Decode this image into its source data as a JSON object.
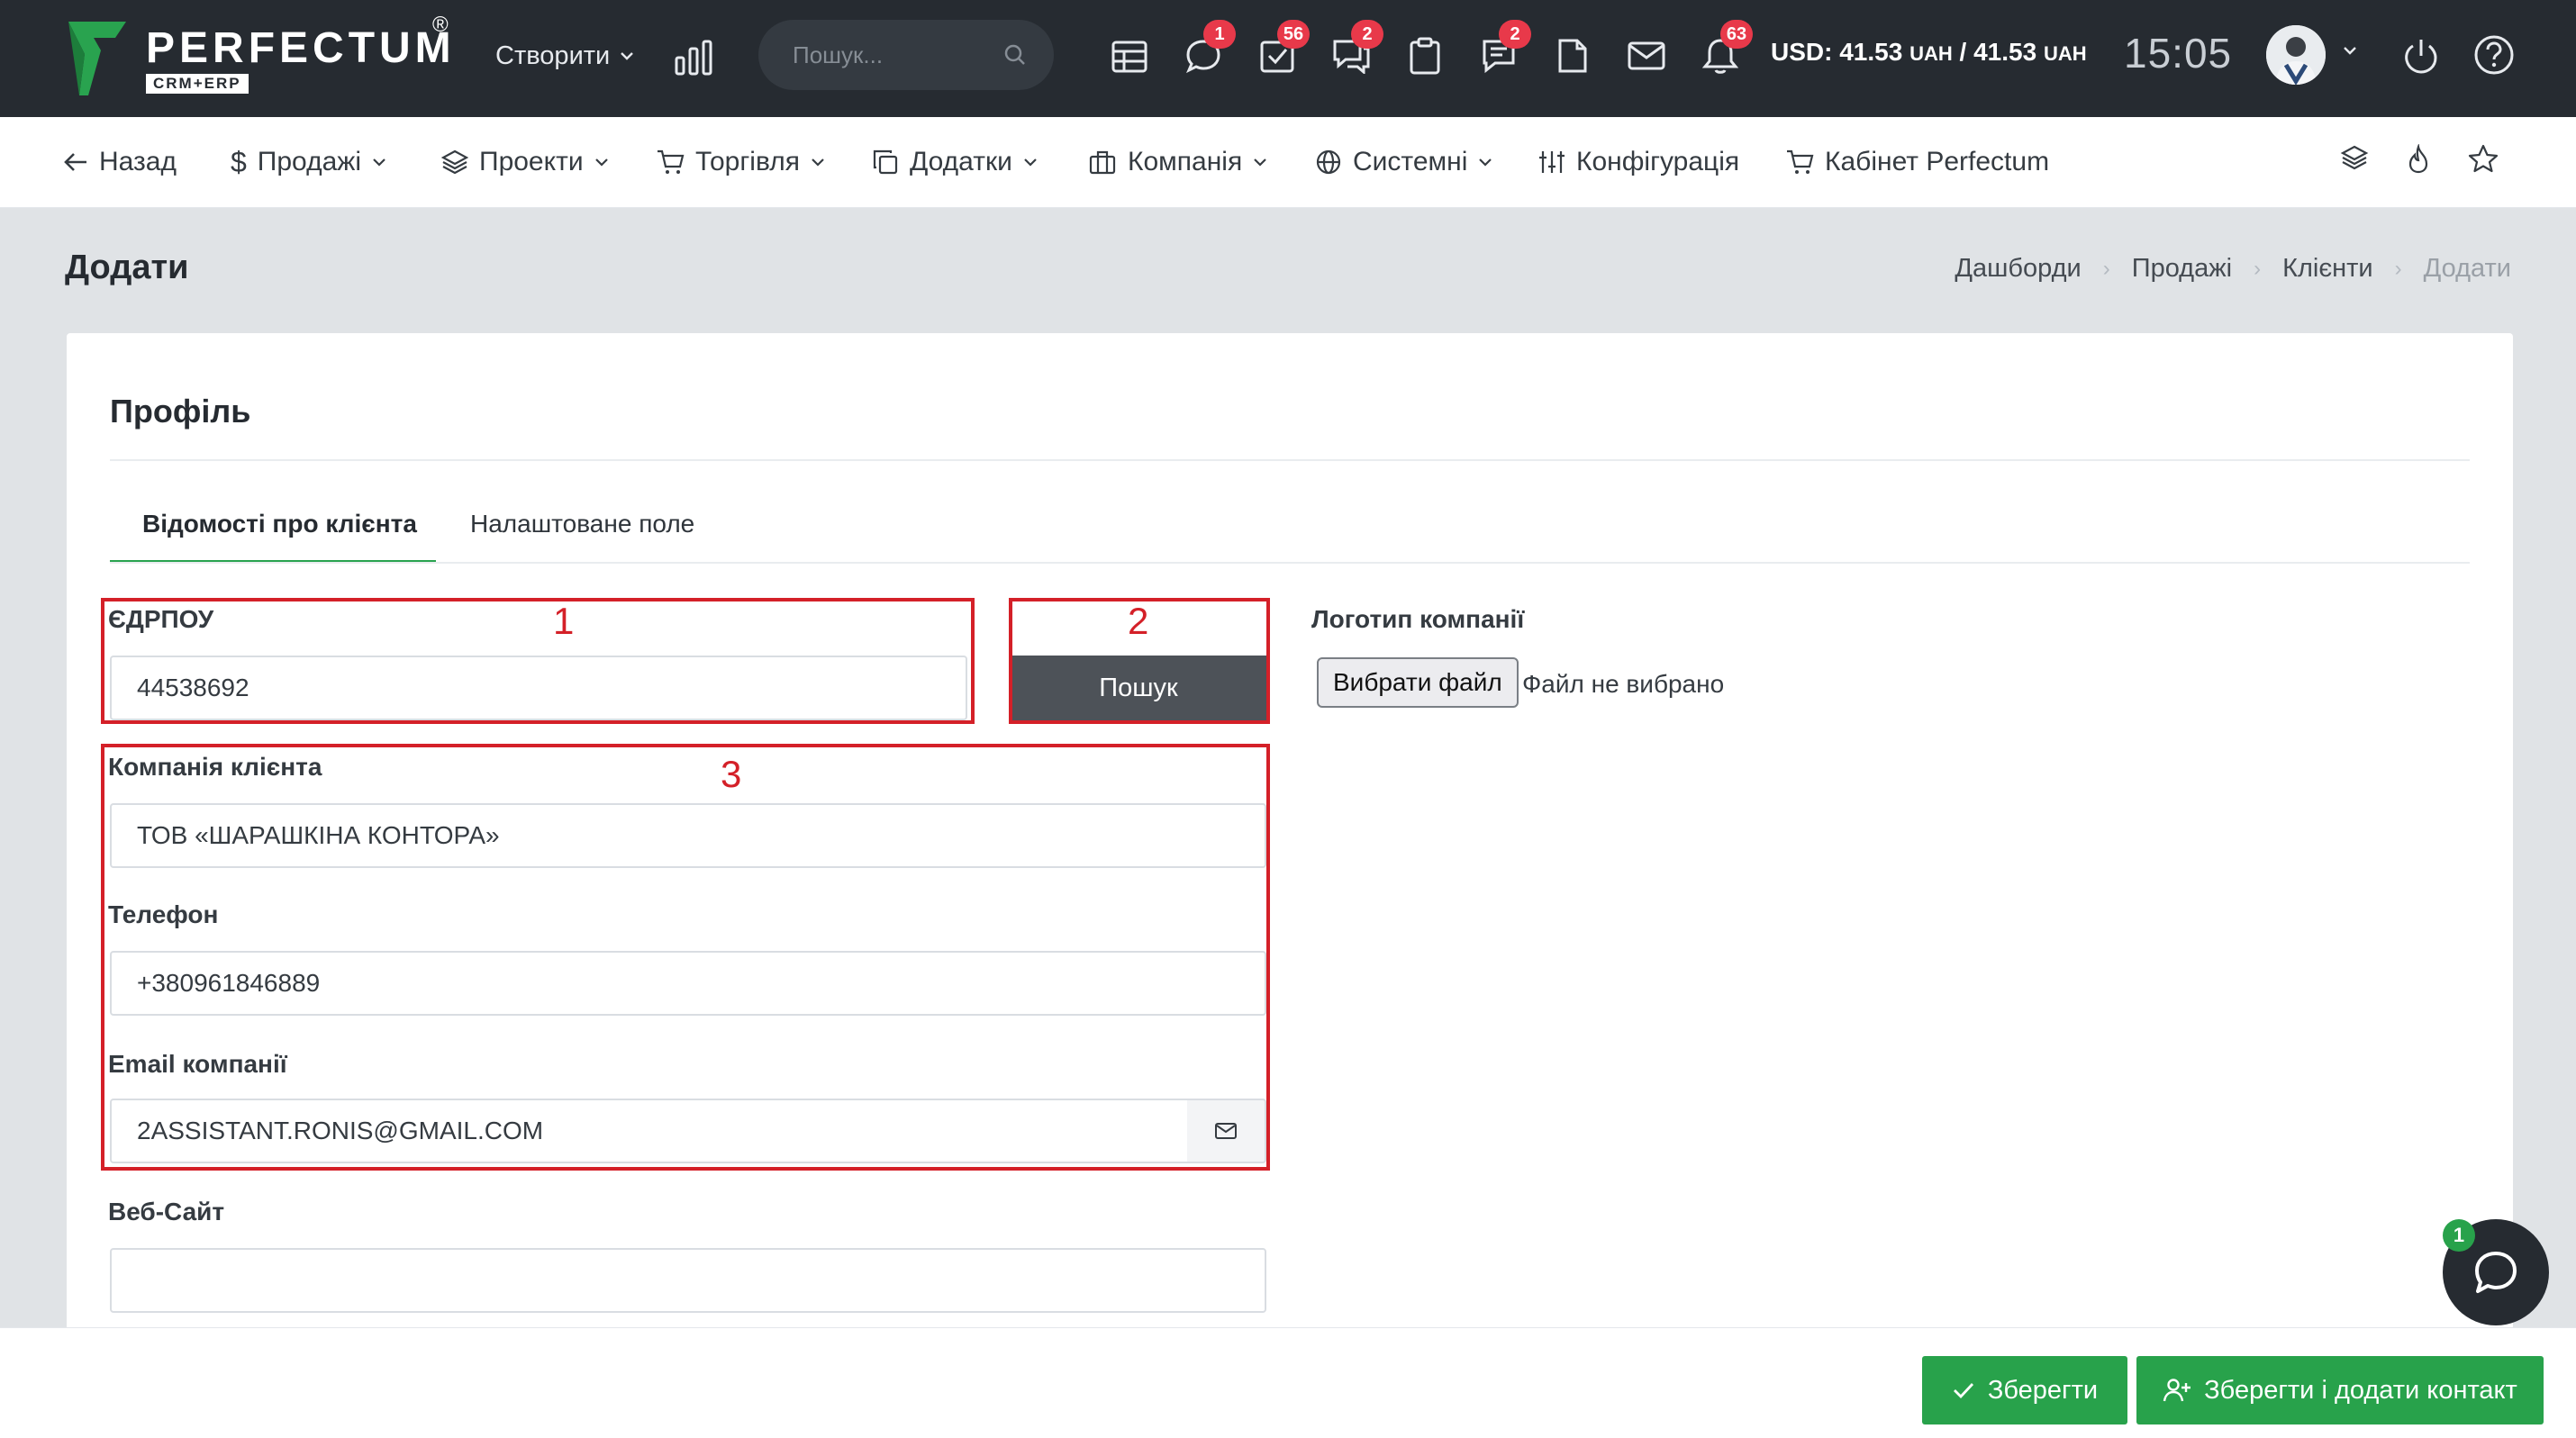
{
  "brand": {
    "name": "PERFECTUM",
    "registered": "®",
    "sub": "CRM+ERP",
    "color": "#29a34f"
  },
  "topbar": {
    "create_label": "Створити",
    "search_placeholder": "Пошук...",
    "badges": {
      "chat": "1",
      "tasks": "56",
      "discussions": "2",
      "notes": "2",
      "notifications": "63"
    },
    "currency": {
      "prefix": "USD: 41.53 ",
      "unit1": "UAH",
      "mid": " / 41.53 ",
      "unit2": "UAH"
    },
    "time": "15:05"
  },
  "nav": {
    "back": "Назад",
    "sales": "Продажі",
    "projects": "Проекти",
    "trade": "Торгівля",
    "addons": "Додатки",
    "company": "Компанія",
    "system": "Системні",
    "config": "Конфігурація",
    "cabinet": "Кабінет Perfectum"
  },
  "page": {
    "title": "Додати",
    "breadcrumbs": [
      "Дашборди",
      "Продажі",
      "Клієнти",
      "Додати"
    ]
  },
  "card": {
    "title": "Профіль",
    "tabs": [
      "Відомості про клієнта",
      "Налаштоване поле"
    ]
  },
  "form": {
    "edrpou": {
      "label": "ЄДРПОУ",
      "value": "44538692"
    },
    "search_button": "Пошук",
    "logo": {
      "label": "Логотип компанії",
      "button": "Вибрати файл",
      "status": "Файл не вибрано"
    },
    "company": {
      "label": "Компанія клієнта",
      "value": "ТОВ «ШАРАШКІНА КОНТОРА»"
    },
    "phone": {
      "label": "Телефон",
      "value": "+380961846889"
    },
    "email": {
      "label": "Email компанії",
      "value": "2ASSISTANT.RONIS@GMAIL.COM"
    },
    "website": {
      "label": "Веб-Сайт",
      "value": ""
    }
  },
  "annotations": [
    "1",
    "2",
    "3"
  ],
  "actions": {
    "save": "Зберегти",
    "save_add_contact": "Зберегти і додати контакт"
  },
  "chat": {
    "badge": "1"
  },
  "colors": {
    "topbar": "#262b31",
    "accent": "#28a24b",
    "badge": "#e8394a",
    "annotation": "#d42028",
    "button_dark": "#4d5258"
  }
}
